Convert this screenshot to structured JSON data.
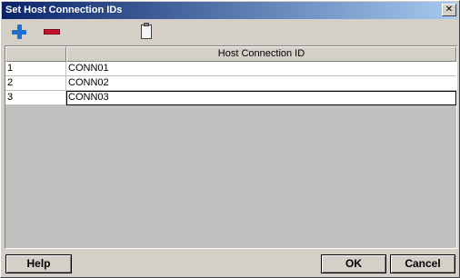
{
  "window": {
    "title": "Set Host Connection IDs",
    "close_glyph": "✕"
  },
  "toolbar": {
    "add_icon": "add-icon",
    "remove_icon": "remove-icon",
    "paste_icon": "clipboard-icon",
    "colors": {
      "add": "#1e6fd0",
      "remove": "#c8102e"
    }
  },
  "grid": {
    "columns": [
      "",
      "Host Connection ID"
    ],
    "rows": [
      {
        "num": "1",
        "id": "CONN01"
      },
      {
        "num": "2",
        "id": "CONN02"
      },
      {
        "num": "3",
        "id": "CONN03"
      }
    ]
  },
  "buttons": {
    "help": "Help",
    "ok": "OK",
    "cancel": "Cancel"
  }
}
